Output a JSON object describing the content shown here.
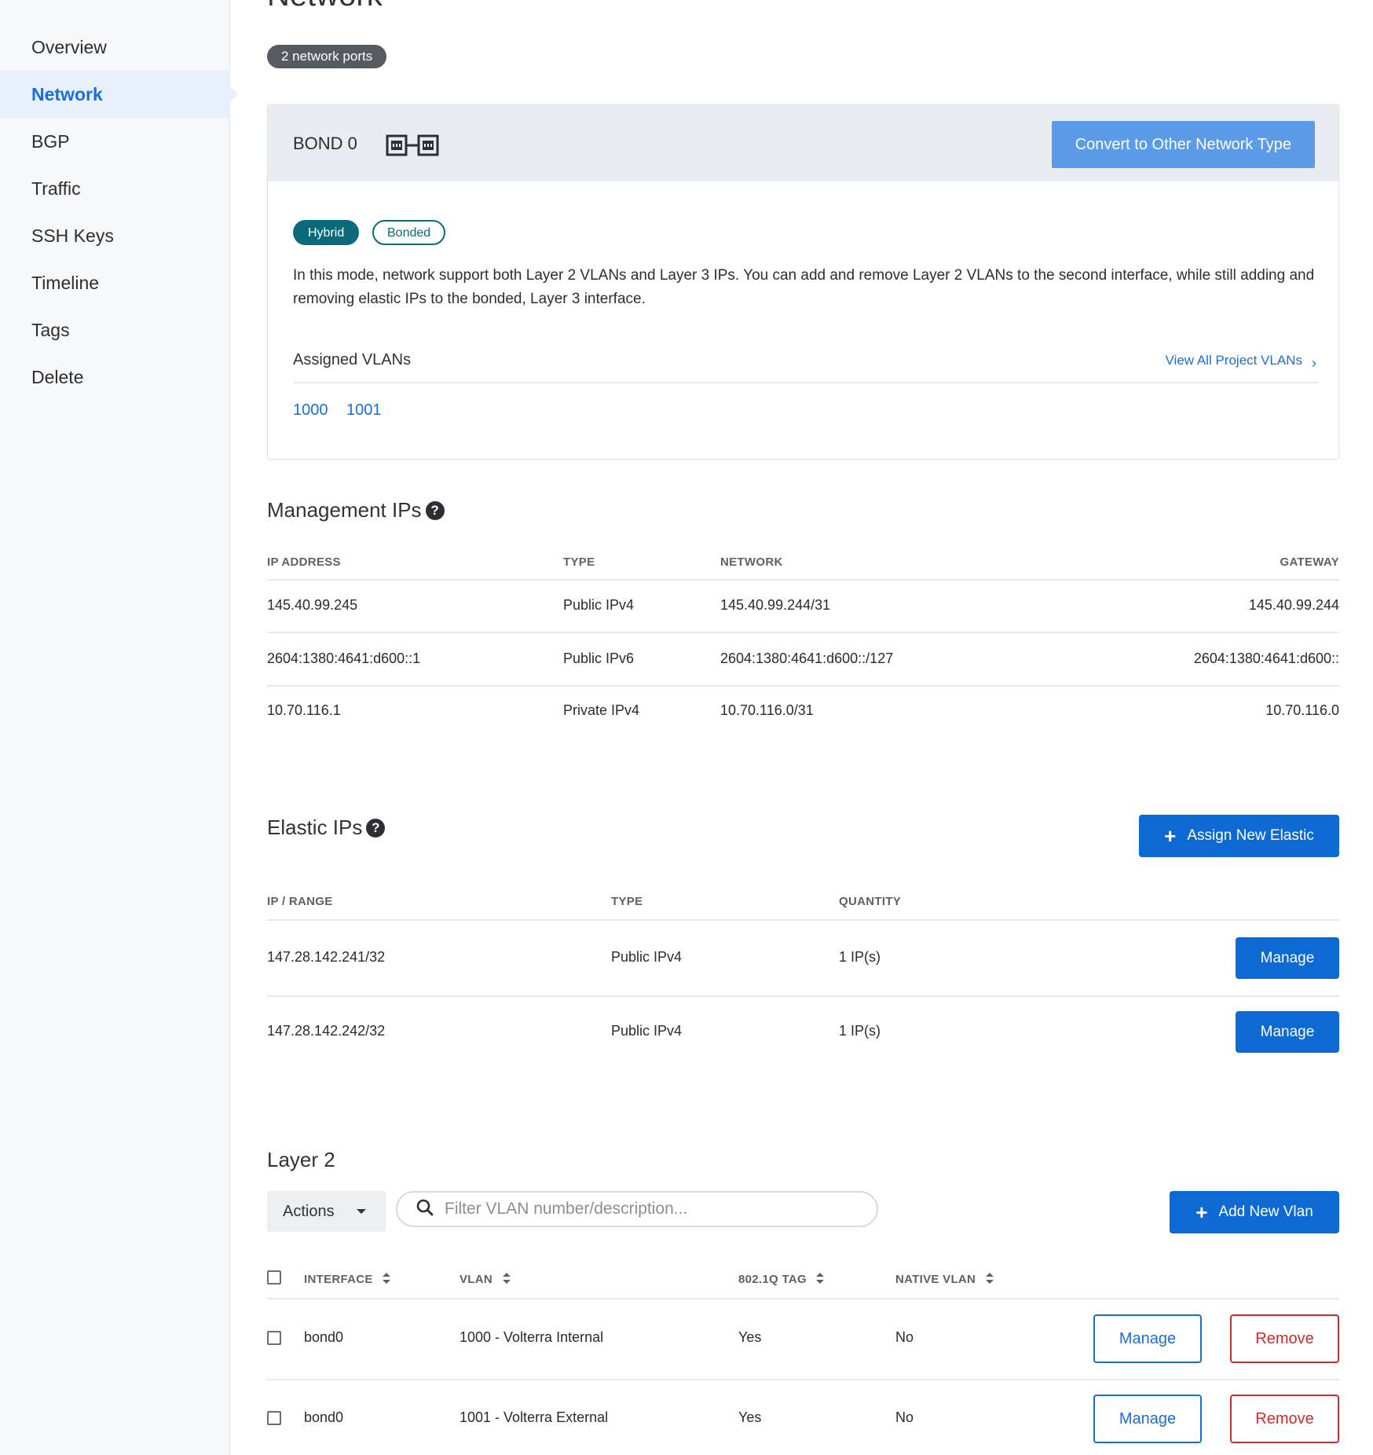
{
  "sidebar": {
    "items": [
      {
        "label": "Overview"
      },
      {
        "label": "Network"
      },
      {
        "label": "BGP"
      },
      {
        "label": "Traffic"
      },
      {
        "label": "SSH Keys"
      },
      {
        "label": "Timeline"
      },
      {
        "label": "Tags"
      },
      {
        "label": "Delete"
      }
    ],
    "active": "Network"
  },
  "page": {
    "title": "Network",
    "ports_badge": "2 network ports"
  },
  "bond": {
    "title": "BOND 0",
    "icon": "bond-ports-icon",
    "convert_label": "Convert to Other Network Type",
    "pills": {
      "hybrid": "Hybrid",
      "bonded": "Bonded"
    },
    "description": "In this mode, network support both Layer 2 VLANs and Layer 3 IPs. You can add and remove Layer 2 VLANs to the second interface, while still adding and removing elastic IPs to the bonded, Layer 3 interface.",
    "assigned_label": "Assigned VLANs",
    "view_all_label": "View All Project VLANs",
    "vlans": [
      "1000",
      "1001"
    ]
  },
  "management": {
    "title": "Management IPs",
    "headers": {
      "ip": "IP ADDRESS",
      "type": "TYPE",
      "network": "NETWORK",
      "gateway": "GATEWAY"
    },
    "rows": [
      {
        "ip": "145.40.99.245",
        "type": "Public IPv4",
        "network": "145.40.99.244/31",
        "gateway": "145.40.99.244"
      },
      {
        "ip": "2604:1380:4641:d600::1",
        "type": "Public IPv6",
        "network": "2604:1380:4641:d600::/127",
        "gateway": "2604:1380:4641:d600::"
      },
      {
        "ip": "10.70.116.1",
        "type": "Private IPv4",
        "network": "10.70.116.0/31",
        "gateway": "10.70.116.0"
      }
    ]
  },
  "elastic": {
    "title": "Elastic IPs",
    "assign_label": "Assign New Elastic",
    "headers": {
      "range": "IP / RANGE",
      "type": "TYPE",
      "quantity": "QUANTITY"
    },
    "rows": [
      {
        "range": "147.28.142.241/32",
        "type": "Public IPv4",
        "quantity": "1 IP(s)",
        "manage": "Manage"
      },
      {
        "range": "147.28.142.242/32",
        "type": "Public IPv4",
        "quantity": "1 IP(s)",
        "manage": "Manage"
      }
    ]
  },
  "layer2": {
    "title": "Layer 2",
    "actions_label": "Actions",
    "search_placeholder": "Filter VLAN number/description...",
    "add_label": "Add New Vlan",
    "headers": {
      "interface": "INTERFACE",
      "vlan": "VLAN",
      "tag": "802.1Q TAG",
      "native": "NATIVE VLAN"
    },
    "rows": [
      {
        "interface": "bond0",
        "vlan": "1000 - Volterra Internal",
        "tag": "Yes",
        "native": "No",
        "manage": "Manage",
        "remove": "Remove"
      },
      {
        "interface": "bond0",
        "vlan": "1001 - Volterra External",
        "tag": "Yes",
        "native": "No",
        "manage": "Manage",
        "remove": "Remove"
      }
    ]
  },
  "colors": {
    "accent": "#0d6ad4",
    "link": "#1a6ed8",
    "teal": "#0b6b7a",
    "danger": "#d02c2c"
  }
}
